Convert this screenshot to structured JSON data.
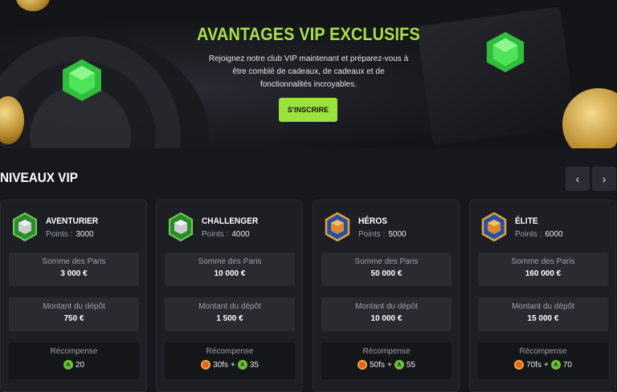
{
  "hero": {
    "title": "AVANTAGES VIP EXCLUSIFS",
    "line1": "Rejoignez notre club VIP maintenant et préparez-vous à",
    "line2": "être comblé de cadeaux, de cadeaux et de",
    "line3": "fonctionnalités incroyables.",
    "cta_label": "S'INSCRIRE",
    "accent_color": "#a8e04a"
  },
  "levels_section": {
    "title": "NIVEAUX VIP",
    "prev_icon": "chevron-left-icon",
    "next_icon": "chevron-right-icon"
  },
  "labels": {
    "points": "Points :",
    "bets": "Somme des Paris",
    "deposit": "Montant du dépôt",
    "reward": "Récompense",
    "plus": "+",
    "a": "A"
  },
  "levels": [
    {
      "name": "AVENTURIER",
      "points": "3000",
      "bets": "3 000 €",
      "deposit": "750 €",
      "reward_fs": "",
      "reward_a": "20",
      "badge": "green-badge"
    },
    {
      "name": "CHALLENGER",
      "points": "4000",
      "bets": "10 000 €",
      "deposit": "1 500 €",
      "reward_fs": "30fs",
      "reward_a": "35",
      "badge": "green-badge"
    },
    {
      "name": "HÉROS",
      "points": "5000",
      "bets": "50 000 €",
      "deposit": "10 000 €",
      "reward_fs": "50fs",
      "reward_a": "55",
      "badge": "blue-gold-badge"
    },
    {
      "name": "ÉLITE",
      "points": "6000",
      "bets": "160 000 €",
      "deposit": "15 000 €",
      "reward_fs": "70fs",
      "reward_a": "70",
      "badge": "blue-gold-badge"
    }
  ]
}
